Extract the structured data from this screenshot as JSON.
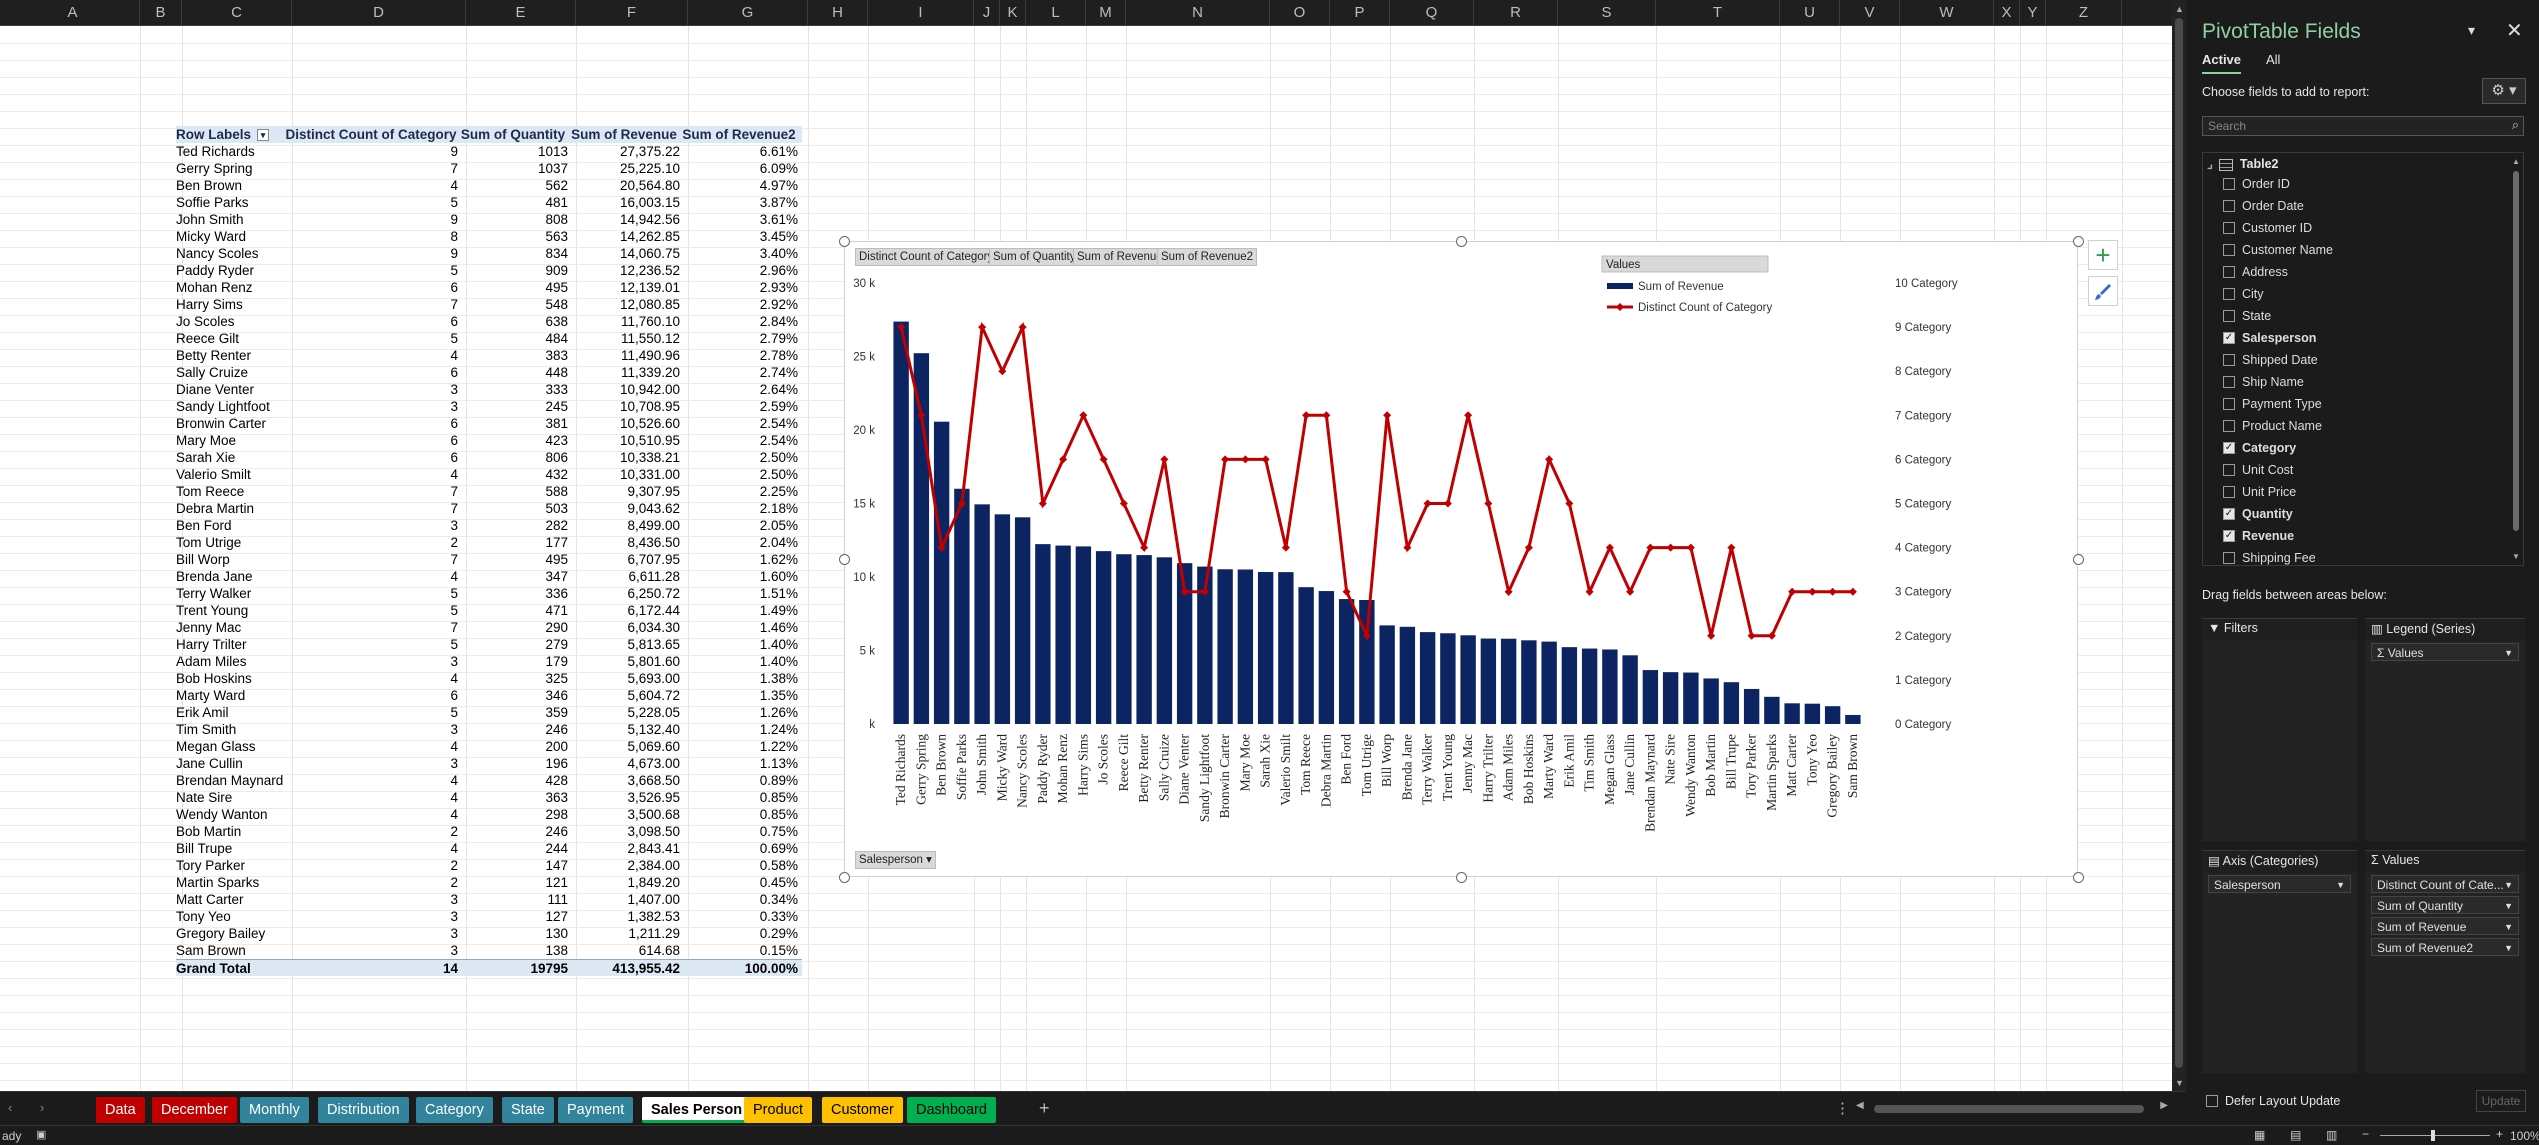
{
  "columns": [
    {
      "label": "A",
      "w": 134
    },
    {
      "label": "B",
      "w": 42
    },
    {
      "label": "C",
      "w": 110
    },
    {
      "label": "D",
      "w": 174
    },
    {
      "label": "E",
      "w": 110
    },
    {
      "label": "F",
      "w": 112
    },
    {
      "label": "G",
      "w": 120
    },
    {
      "label": "H",
      "w": 60
    },
    {
      "label": "I",
      "w": 106
    },
    {
      "label": "J",
      "w": 26
    },
    {
      "label": "K",
      "w": 26
    },
    {
      "label": "L",
      "w": 60
    },
    {
      "label": "M",
      "w": 40
    },
    {
      "label": "N",
      "w": 144
    },
    {
      "label": "O",
      "w": 60
    },
    {
      "label": "P",
      "w": 60
    },
    {
      "label": "Q",
      "w": 84
    },
    {
      "label": "R",
      "w": 84
    },
    {
      "label": "S",
      "w": 98
    },
    {
      "label": "T",
      "w": 124
    },
    {
      "label": "U",
      "w": 60
    },
    {
      "label": "V",
      "w": 60
    },
    {
      "label": "W",
      "w": 94
    },
    {
      "label": "X",
      "w": 26
    },
    {
      "label": "Y",
      "w": 26
    },
    {
      "label": "Z",
      "w": 76
    }
  ],
  "pivot": {
    "headers": [
      "Row Labels",
      "Distinct Count of Category",
      "Sum of Quantity",
      "Sum of Revenue",
      "Sum of Revenue2"
    ],
    "filter_icon": "filter-dropdown-icon",
    "rows": [
      [
        "Ted Richards",
        "9",
        "1013",
        "27,375.22",
        "6.61%"
      ],
      [
        "Gerry Spring",
        "7",
        "1037",
        "25,225.10",
        "6.09%"
      ],
      [
        "Ben Brown",
        "4",
        "562",
        "20,564.80",
        "4.97%"
      ],
      [
        "Soffie Parks",
        "5",
        "481",
        "16,003.15",
        "3.87%"
      ],
      [
        "John Smith",
        "9",
        "808",
        "14,942.56",
        "3.61%"
      ],
      [
        "Micky Ward",
        "8",
        "563",
        "14,262.85",
        "3.45%"
      ],
      [
        "Nancy Scoles",
        "9",
        "834",
        "14,060.75",
        "3.40%"
      ],
      [
        "Paddy Ryder",
        "5",
        "909",
        "12,236.52",
        "2.96%"
      ],
      [
        "Mohan Renz",
        "6",
        "495",
        "12,139.01",
        "2.93%"
      ],
      [
        "Harry Sims",
        "7",
        "548",
        "12,080.85",
        "2.92%"
      ],
      [
        "Jo Scoles",
        "6",
        "638",
        "11,760.10",
        "2.84%"
      ],
      [
        "Reece Gilt",
        "5",
        "484",
        "11,550.12",
        "2.79%"
      ],
      [
        "Betty Renter",
        "4",
        "383",
        "11,490.96",
        "2.78%"
      ],
      [
        "Sally Cruize",
        "6",
        "448",
        "11,339.20",
        "2.74%"
      ],
      [
        "Diane Venter",
        "3",
        "333",
        "10,942.00",
        "2.64%"
      ],
      [
        "Sandy Lightfoot",
        "3",
        "245",
        "10,708.95",
        "2.59%"
      ],
      [
        "Bronwin Carter",
        "6",
        "381",
        "10,526.60",
        "2.54%"
      ],
      [
        "Mary Moe",
        "6",
        "423",
        "10,510.95",
        "2.54%"
      ],
      [
        "Sarah Xie",
        "6",
        "806",
        "10,338.21",
        "2.50%"
      ],
      [
        "Valerio Smilt",
        "4",
        "432",
        "10,331.00",
        "2.50%"
      ],
      [
        "Tom Reece",
        "7",
        "588",
        "9,307.95",
        "2.25%"
      ],
      [
        "Debra Martin",
        "7",
        "503",
        "9,043.62",
        "2.18%"
      ],
      [
        "Ben Ford",
        "3",
        "282",
        "8,499.00",
        "2.05%"
      ],
      [
        "Tom Utrige",
        "2",
        "177",
        "8,436.50",
        "2.04%"
      ],
      [
        "Bill Worp",
        "7",
        "495",
        "6,707.95",
        "1.62%"
      ],
      [
        "Brenda Jane",
        "4",
        "347",
        "6,611.28",
        "1.60%"
      ],
      [
        "Terry Walker",
        "5",
        "336",
        "6,250.72",
        "1.51%"
      ],
      [
        "Trent Young",
        "5",
        "471",
        "6,172.44",
        "1.49%"
      ],
      [
        "Jenny Mac",
        "7",
        "290",
        "6,034.30",
        "1.46%"
      ],
      [
        "Harry Trilter",
        "5",
        "279",
        "5,813.65",
        "1.40%"
      ],
      [
        "Adam Miles",
        "3",
        "179",
        "5,801.60",
        "1.40%"
      ],
      [
        "Bob Hoskins",
        "4",
        "325",
        "5,693.00",
        "1.38%"
      ],
      [
        "Marty Ward",
        "6",
        "346",
        "5,604.72",
        "1.35%"
      ],
      [
        "Erik Amil",
        "5",
        "359",
        "5,228.05",
        "1.26%"
      ],
      [
        "Tim Smith",
        "3",
        "246",
        "5,132.40",
        "1.24%"
      ],
      [
        "Megan Glass",
        "4",
        "200",
        "5,069.60",
        "1.22%"
      ],
      [
        "Jane Cullin",
        "3",
        "196",
        "4,673.00",
        "1.13%"
      ],
      [
        "Brendan Maynard",
        "4",
        "428",
        "3,668.50",
        "0.89%"
      ],
      [
        "Nate Sire",
        "4",
        "363",
        "3,526.95",
        "0.85%"
      ],
      [
        "Wendy Wanton",
        "4",
        "298",
        "3,500.68",
        "0.85%"
      ],
      [
        "Bob Martin",
        "2",
        "246",
        "3,098.50",
        "0.75%"
      ],
      [
        "Bill Trupe",
        "4",
        "244",
        "2,843.41",
        "0.69%"
      ],
      [
        "Tory Parker",
        "2",
        "147",
        "2,384.00",
        "0.58%"
      ],
      [
        "Martin Sparks",
        "2",
        "121",
        "1,849.20",
        "0.45%"
      ],
      [
        "Matt Carter",
        "3",
        "111",
        "1,407.00",
        "0.34%"
      ],
      [
        "Tony Yeo",
        "3",
        "127",
        "1,382.53",
        "0.33%"
      ],
      [
        "Gregory Bailey",
        "3",
        "130",
        "1,211.29",
        "0.29%"
      ],
      [
        "Sam Brown",
        "3",
        "138",
        "614.68",
        "0.15%"
      ]
    ],
    "total": [
      "Grand Total",
      "14",
      "19795",
      "413,955.42",
      "100.00%"
    ]
  },
  "chart_data": {
    "type": "bar",
    "field_buttons": [
      "Distinct Count of Category",
      "Sum of Quantity",
      "Sum of Revenue",
      "Sum of Revenue2"
    ],
    "axis_button": "Salesperson",
    "legend_title": "Values",
    "categories": [
      "Ted Richards",
      "Gerry Spring",
      "Ben Brown",
      "Soffie Parks",
      "John Smith",
      "Micky Ward",
      "Nancy Scoles",
      "Paddy Ryder",
      "Mohan Renz",
      "Harry Sims",
      "Jo Scoles",
      "Reece Gilt",
      "Betty Renter",
      "Sally Cruize",
      "Diane Venter",
      "Sandy Lightfoot",
      "Bronwin Carter",
      "Mary Moe",
      "Sarah Xie",
      "Valerio Smilt",
      "Tom Reece",
      "Debra Martin",
      "Ben Ford",
      "Tom Utrige",
      "Bill Worp",
      "Brenda Jane",
      "Terry Walker",
      "Trent Young",
      "Jenny Mac",
      "Harry Trilter",
      "Adam Miles",
      "Bob Hoskins",
      "Marty Ward",
      "Erik Amil",
      "Tim Smith",
      "Megan Glass",
      "Jane Cullin",
      "Brendan Maynard",
      "Nate Sire",
      "Wendy Wanton",
      "Bob Martin",
      "Bill Trupe",
      "Tory Parker",
      "Martin Sparks",
      "Matt Carter",
      "Tony Yeo",
      "Gregory Bailey",
      "Sam Brown"
    ],
    "series": [
      {
        "name": "Sum of Revenue",
        "type": "bar",
        "axis": "left",
        "color": "#0d2463",
        "values": [
          27375.22,
          25225.1,
          20564.8,
          16003.15,
          14942.56,
          14262.85,
          14060.75,
          12236.52,
          12139.01,
          12080.85,
          11760.1,
          11550.12,
          11490.96,
          11339.2,
          10942.0,
          10708.95,
          10526.6,
          10510.95,
          10338.21,
          10331.0,
          9307.95,
          9043.62,
          8499.0,
          8436.5,
          6707.95,
          6611.28,
          6250.72,
          6172.44,
          6034.3,
          5813.65,
          5801.6,
          5693.0,
          5604.72,
          5228.05,
          5132.4,
          5069.6,
          4673.0,
          3668.5,
          3526.95,
          3500.68,
          3098.5,
          2843.41,
          2384.0,
          1849.2,
          1407.0,
          1382.53,
          1211.29,
          614.68
        ]
      },
      {
        "name": "Distinct Count of Category",
        "type": "line",
        "axis": "right",
        "color": "#c00000",
        "values": [
          9,
          7,
          4,
          5,
          9,
          8,
          9,
          5,
          6,
          7,
          6,
          5,
          4,
          6,
          3,
          3,
          6,
          6,
          6,
          4,
          7,
          7,
          3,
          2,
          7,
          4,
          5,
          5,
          7,
          5,
          3,
          4,
          6,
          5,
          3,
          4,
          3,
          4,
          4,
          4,
          2,
          4,
          2,
          2,
          3,
          3,
          3,
          3
        ]
      }
    ],
    "left_ticks": [
      "30 k",
      "25 k",
      "20 k",
      "15 k",
      "10 k",
      "5 k",
      "k"
    ],
    "right_ticks": [
      "10 Category",
      "9 Category",
      "8 Category",
      "7 Category",
      "6 Category",
      "5 Category",
      "4 Category",
      "3 Category",
      "2 Category",
      "1 Category",
      "0 Category"
    ],
    "ylim_left": [
      0,
      30000
    ],
    "ylim_right": [
      0,
      10
    ],
    "legend_position": "top-right"
  },
  "side_buttons": {
    "add_icon": "plus-icon",
    "style_icon": "brush-icon"
  },
  "panel": {
    "title": "PivotTable Fields",
    "tab_active": "Active",
    "tab_all": "All",
    "subtitle": "Choose fields to add to report:",
    "search_placeholder": "Search",
    "table_name": "Table2",
    "fields": [
      {
        "name": "Order ID",
        "checked": false
      },
      {
        "name": "Order Date",
        "checked": false
      },
      {
        "name": "Customer ID",
        "checked": false
      },
      {
        "name": "Customer Name",
        "checked": false
      },
      {
        "name": "Address",
        "checked": false
      },
      {
        "name": "City",
        "checked": false
      },
      {
        "name": "State",
        "checked": false
      },
      {
        "name": "Salesperson",
        "checked": true
      },
      {
        "name": "Shipped Date",
        "checked": false
      },
      {
        "name": "Ship Name",
        "checked": false
      },
      {
        "name": "Payment Type",
        "checked": false
      },
      {
        "name": "Product Name",
        "checked": false
      },
      {
        "name": "Category",
        "checked": true
      },
      {
        "name": "Unit Cost",
        "checked": false
      },
      {
        "name": "Unit Price",
        "checked": false
      },
      {
        "name": "Quantity",
        "checked": true
      },
      {
        "name": "Revenue",
        "checked": true
      },
      {
        "name": "Shipping Fee",
        "checked": false
      }
    ],
    "drag_hint": "Drag fields between areas below:",
    "filters_label": "Filters",
    "legend_label": "Legend (Series)",
    "legend_item": "Σ Values",
    "axis_label": "Axis (Categories)",
    "axis_item": "Salesperson",
    "values_label": "Σ Values",
    "values_items": [
      "Distinct Count of Cate...",
      "Sum of Quantity",
      "Sum of Revenue",
      "Sum of Revenue2"
    ],
    "defer_label": "Defer Layout Update",
    "update_button": "Update"
  },
  "tabs": [
    {
      "label": "Data",
      "bg": "#c00000",
      "fg": "#ffffff",
      "active": false
    },
    {
      "label": "December",
      "bg": "#c00000",
      "fg": "#ffffff",
      "active": false
    },
    {
      "label": "Monthly",
      "bg": "#31849b",
      "fg": "#ffffff",
      "active": false
    },
    {
      "label": "Distribution",
      "bg": "#31849b",
      "fg": "#ffffff",
      "active": false
    },
    {
      "label": "Category",
      "bg": "#31849b",
      "fg": "#ffffff",
      "active": false
    },
    {
      "label": "State",
      "bg": "#31849b",
      "fg": "#ffffff",
      "active": false
    },
    {
      "label": "Payment",
      "bg": "#31849b",
      "fg": "#ffffff",
      "active": false
    },
    {
      "label": "Sales Person",
      "bg": "#ffffff",
      "fg": "#000000",
      "active": true
    },
    {
      "label": "Product",
      "bg": "#ffc000",
      "fg": "#000000",
      "active": false
    },
    {
      "label": "Customer",
      "bg": "#ffc000",
      "fg": "#000000",
      "active": false
    },
    {
      "label": "Dashboard",
      "bg": "#00b050",
      "fg": "#000000",
      "active": false
    }
  ],
  "status": {
    "ready": "ady",
    "zoom": "100%"
  }
}
